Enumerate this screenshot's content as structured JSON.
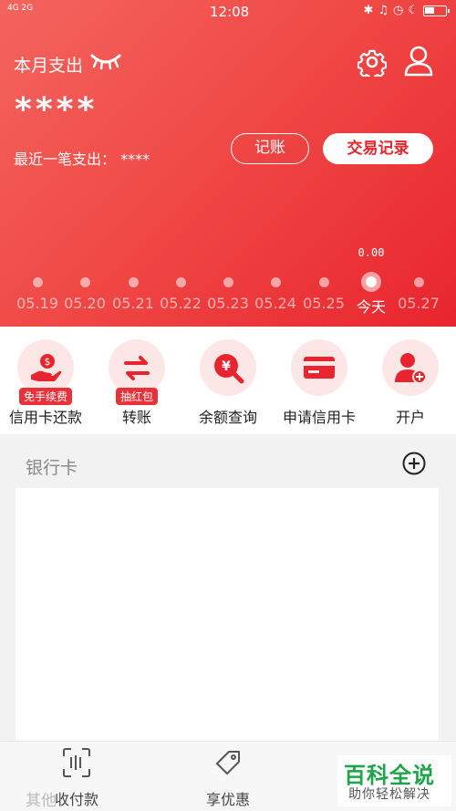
{
  "statusbar": {
    "signal": "4G 2G",
    "time": "12:08"
  },
  "header": {
    "month_label": "本月支出",
    "amount": "****",
    "recent_label": "最近一笔支出：",
    "recent_value": "****",
    "record_button": "记账",
    "transactions_button": "交易记录"
  },
  "timeline": {
    "items": [
      {
        "date": "05.19",
        "value": ""
      },
      {
        "date": "05.20",
        "value": ""
      },
      {
        "date": "05.21",
        "value": ""
      },
      {
        "date": "05.22",
        "value": ""
      },
      {
        "date": "05.23",
        "value": ""
      },
      {
        "date": "05.24",
        "value": ""
      },
      {
        "date": "05.25",
        "value": ""
      },
      {
        "date": "今天",
        "value": "0.00",
        "active": true
      },
      {
        "date": "05.27",
        "value": ""
      }
    ]
  },
  "actions": [
    {
      "label": "信用卡还款",
      "badge": "免手续费",
      "icon": "hand-coin-icon"
    },
    {
      "label": "转账",
      "badge": "抽红包",
      "icon": "transfer-arrows-icon"
    },
    {
      "label": "余额查询",
      "badge": "",
      "icon": "yuan-search-icon"
    },
    {
      "label": "申请信用卡",
      "badge": "",
      "icon": "credit-card-icon"
    },
    {
      "label": "开户",
      "badge": "",
      "icon": "add-user-icon"
    }
  ],
  "bank": {
    "title": "银行卡"
  },
  "bottom_nav": {
    "other": "其他",
    "collect_label": "收付款",
    "offers_label": "享优惠"
  },
  "watermark": {
    "title": "百科全说",
    "subtitle": "助你轻松解决"
  },
  "colors": {
    "accent": "#e8252e",
    "accent_light": "#fde7e6"
  }
}
